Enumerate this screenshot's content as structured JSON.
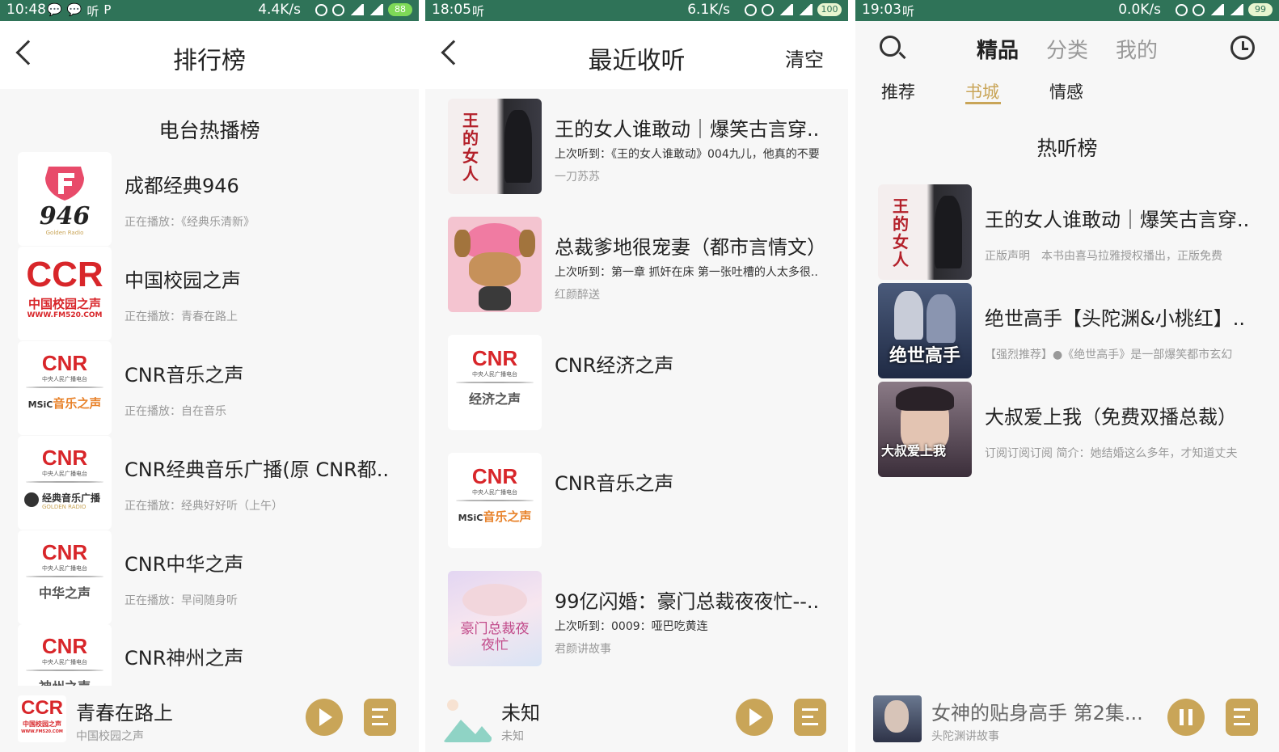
{
  "colors": {
    "status_bar": "#2f7358",
    "accent": "#c9a558",
    "text": "#222222",
    "muted": "#999999"
  },
  "panel1": {
    "status": {
      "time": "10:48",
      "network": "4.4K/s",
      "battery": "88",
      "apps": [
        "💬",
        "💬",
        "听",
        "P"
      ]
    },
    "header": {
      "title": "排行榜"
    },
    "section_title": "电台热播榜",
    "items": [
      {
        "title": "成都经典946",
        "now": "正在播放：《经典乐清新》",
        "thumb": "946"
      },
      {
        "title": "中国校园之声",
        "now": "正在播放：青春在路上",
        "thumb": "ccr"
      },
      {
        "title": "CNR音乐之声",
        "now": "正在播放：自在音乐",
        "thumb": "cnr-music"
      },
      {
        "title": "CNR经典音乐广播(原 CNR都..",
        "now": "正在播放：经典好好听（上午）",
        "thumb": "cnr-classic"
      },
      {
        "title": "CNR中华之声",
        "now": "正在播放：早间随身听",
        "thumb": "cnr-zhonghua"
      },
      {
        "title": "CNR神州之声",
        "now": "",
        "thumb": "cnr-shenzhou"
      }
    ],
    "thumb_text": {
      "f946": "946",
      "f946_small": "Golden Radio",
      "ccr": "CCR",
      "ccr_cn": "中国校园之声",
      "ccr_url": "WWW.FM520.COM",
      "cnr": "CNR",
      "cnr_sub": "中央人民广播电台",
      "music_band": "音乐之声",
      "music_prefix": "MSiC",
      "classic_band": "经典音乐广播",
      "classic_en": "GOLDEN RADIO",
      "zhonghua_band": "中华之声",
      "shenzhou_band": "神州之声"
    },
    "player": {
      "title": "青春在路上",
      "sub": "中国校园之声"
    }
  },
  "panel2": {
    "status": {
      "time": "18:05",
      "network": "6.1K/s",
      "battery": "100",
      "apps": [
        "听"
      ]
    },
    "header": {
      "title": "最近收听",
      "right": "清空"
    },
    "items": [
      {
        "title": "王的女人谁敢动｜爆笑古言穿..",
        "line": "上次听到：《王的女人谁敢动》004九儿，他真的不要",
        "author": "一刀苏苏"
      },
      {
        "title": "总裁爹地很宠妻（都市言情文）",
        "line": "上次听到：第一章 抓奸在床 第一张吐槽的人太多很..",
        "author": "红颜醉送"
      },
      {
        "title": "CNR经济之声",
        "line": "",
        "author": ""
      },
      {
        "title": "CNR音乐之声",
        "line": "",
        "author": ""
      },
      {
        "title": "99亿闪婚：豪门总裁夜夜忙--..",
        "line": "上次听到：0009：哑巴吃黄连",
        "author": "君颜讲故事"
      }
    ],
    "thumb_text": {
      "cover1": "王的女人",
      "economy_band": "经济之声",
      "cover5": "豪门总裁夜夜忙"
    },
    "player": {
      "title": "未知",
      "sub": "未知"
    }
  },
  "panel3": {
    "status": {
      "time": "19:03",
      "network": "0.0K/s",
      "battery": "99",
      "apps": [
        "听"
      ]
    },
    "top_tabs": [
      "精品",
      "分类",
      "我的"
    ],
    "sub_tabs": [
      "推荐",
      "书城",
      "情感"
    ],
    "active_sub_tab": "书城",
    "section_title": "热听榜",
    "items": [
      {
        "title": "王的女人谁敢动｜爆笑古言穿..",
        "desc": "正版声明　本书由喜马拉雅授权播出，正版免费"
      },
      {
        "title": "绝世高手【头陀渊&小桃红】..",
        "desc": "【强烈推荐】●《绝世高手》是一部爆笑都市玄幻"
      },
      {
        "title": "大叔爱上我（免费双播总裁）",
        "desc": "订阅订阅订阅 简介：她结婚这么多年，才知道丈夫"
      }
    ],
    "thumb_text": {
      "cover1": "王的女人",
      "cover2": "绝世高手",
      "cover3": "大叔爱上我"
    },
    "player": {
      "title": "女神的贴身高手 第2集...",
      "sub": "头陀渊讲故事"
    }
  }
}
